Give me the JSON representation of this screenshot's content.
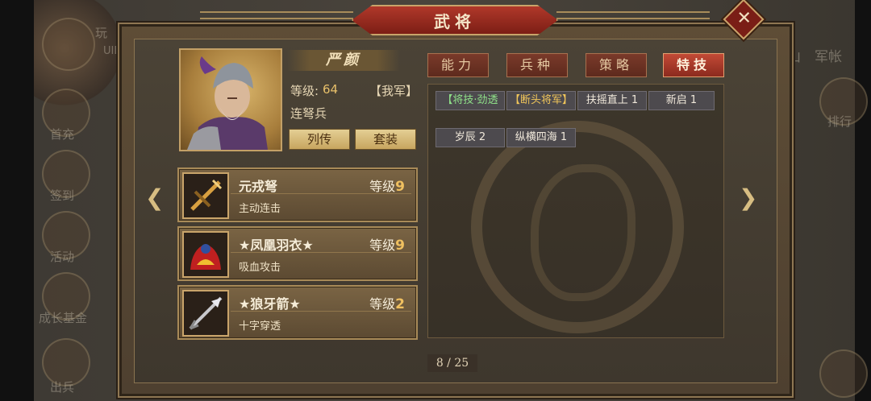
{
  "window": {
    "title": "武将"
  },
  "background": {
    "left_labels": [
      "首充",
      "签到",
      "活动",
      "成长基金",
      "出兵"
    ],
    "top_labels": [
      "玩",
      "UID"
    ],
    "right_labels": [
      "山",
      "军帐",
      "排行"
    ]
  },
  "general": {
    "name": "严颜",
    "level_label": "等级:",
    "level": "64",
    "faction": "【我军】",
    "troop_type": "连弩兵",
    "biography_button": "列传",
    "outfit_button": "套装"
  },
  "skills": [
    {
      "name": "元戎弩",
      "level_label": "等级",
      "level": "9",
      "desc": "主动连击",
      "icon": "crossbow-icon"
    },
    {
      "name": "★凤凰羽衣★",
      "level_label": "等级",
      "level": "9",
      "desc": "吸血攻击",
      "icon": "phoenix-armor-icon"
    },
    {
      "name": "★狼牙箭★",
      "level_label": "等级",
      "level": "2",
      "desc": "十字穿透",
      "icon": "arrow-icon"
    }
  ],
  "tabs": [
    {
      "label": "能力",
      "active": false
    },
    {
      "label": "兵种",
      "active": false
    },
    {
      "label": "策略",
      "active": false
    },
    {
      "label": "特技",
      "active": true
    }
  ],
  "traits": [
    {
      "label": "【将技·劲透",
      "color": "green"
    },
    {
      "label": "【断头将军】",
      "color": "gold"
    },
    {
      "label": "扶摇直上 1",
      "color": "white"
    },
    {
      "label": "新启 1",
      "color": "white"
    },
    {
      "label": "岁辰 2",
      "color": "white"
    },
    {
      "label": "纵横四海 1",
      "color": "white"
    }
  ],
  "pagination": {
    "text": "8 / 25"
  },
  "colors": {
    "accent_red": "#8c2a1e",
    "gold": "#f0c060",
    "trait_green": "#8fe088"
  }
}
